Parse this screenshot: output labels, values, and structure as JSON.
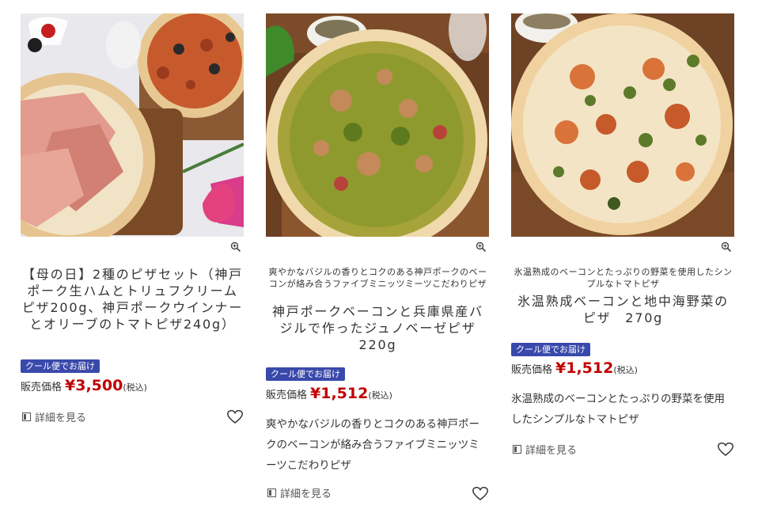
{
  "products": [
    {
      "subtitle": "",
      "title": "【母の日】2種のピザセット（神戸ポーク生ハムとトリュフクリームピザ200g、神戸ポークウインナーとオリーブのトマトピザ240g）",
      "badge": "クール便でお届け",
      "price_label": "販売価格",
      "price": "¥3,500",
      "tax": "(税込)",
      "description": "",
      "detail_label": "詳細を見る"
    },
    {
      "subtitle": "爽やかなバジルの香りとコクのある神戸ポークのベーコンが絡み合うファイブミニッツミーツこだわりピザ",
      "title": "神戸ポークベーコンと兵庫県産バジルで作ったジュノベーゼピザ　220g",
      "badge": "クール便でお届け",
      "price_label": "販売価格",
      "price": "¥1,512",
      "tax": "(税込)",
      "description": "爽やかなバジルの香りとコクのある神戸ポークのベーコンが絡み合うファイブミニッツミーツこだわりピザ",
      "detail_label": "詳細を見る"
    },
    {
      "subtitle": "氷温熟成のベーコンとたっぷりの野菜を使用したシンプルなトマトピザ",
      "title": "氷温熟成ベーコンと地中海野菜のピザ　270g",
      "badge": "クール便でお届け",
      "price_label": "販売価格",
      "price": "¥1,512",
      "tax": "(税込)",
      "description": "氷温熟成のベーコンとたっぷりの野菜を使用したシンプルなトマトピザ",
      "detail_label": "詳細を見る"
    }
  ],
  "icons": {
    "zoom": "zoom-in-icon",
    "detail": "document-icon",
    "favorite": "heart-outline-icon"
  },
  "colors": {
    "badge": "#3949ab",
    "price": "#c00000"
  }
}
